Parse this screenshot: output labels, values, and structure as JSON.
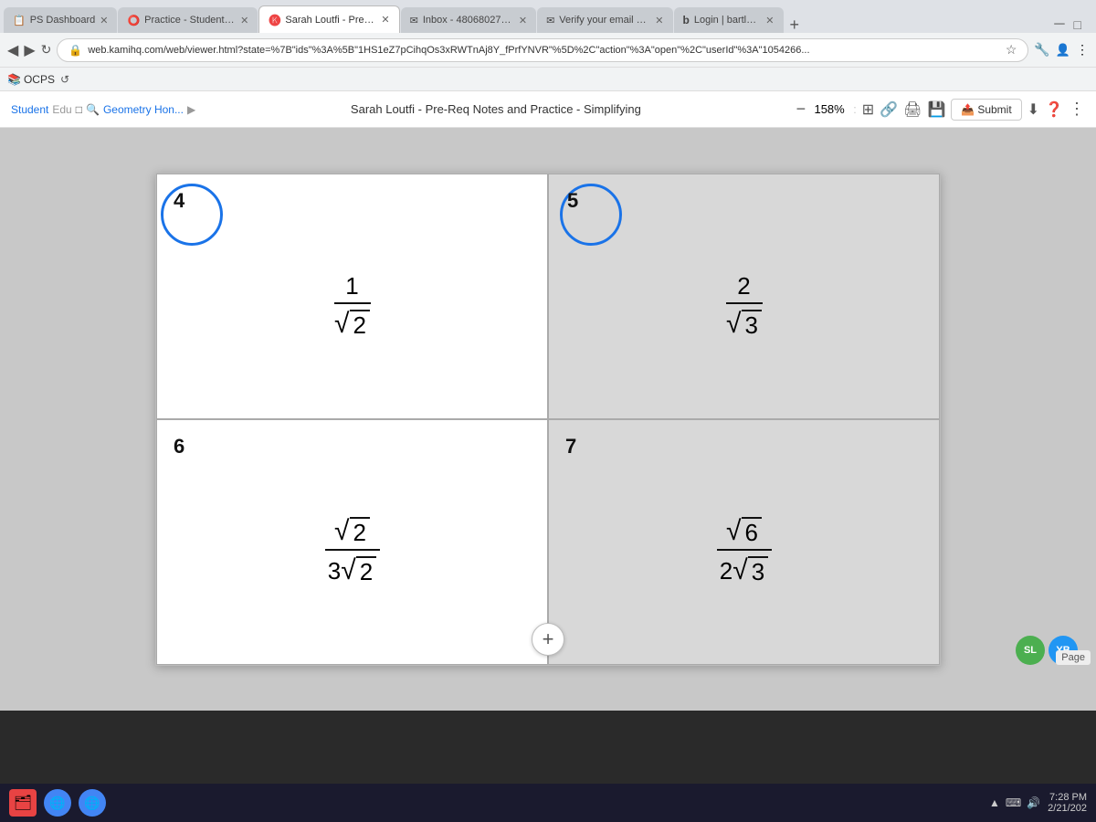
{
  "browser": {
    "tabs": [
      {
        "id": "tab1",
        "label": "PS Dashboard",
        "active": false,
        "icon": "📋"
      },
      {
        "id": "tab2",
        "label": "Practice - Student Cop...",
        "active": false,
        "icon": "⭕"
      },
      {
        "id": "tab3",
        "label": "Sarah Loutfi - Pre-Req...",
        "active": true,
        "icon": "🅚"
      },
      {
        "id": "tab4",
        "label": "Inbox - 4806802792@...",
        "active": false,
        "icon": "✉"
      },
      {
        "id": "tab5",
        "label": "Verify your email addre...",
        "active": false,
        "icon": "✉"
      },
      {
        "id": "tab6",
        "label": "Login | bartleby",
        "active": false,
        "icon": "b"
      }
    ],
    "url": "web.kamihq.com/web/viewer.html?state=%7B\"ids\"%3A%5B\"1HS1eZ7pCihqOs3xRWTnAj8Y_fPrfYNVR\"%5D%2C\"action\"%3A\"open\"%2C\"userId\"%3A\"1054266...",
    "new_tab_label": "+"
  },
  "toolbar_items": [
    "OCPS"
  ],
  "kamihq": {
    "breadcrumb": {
      "student": "Student",
      "edu": "Edu",
      "geometry": "Geometry Hon...",
      "arrow": "▶",
      "page_title": "Sarah Loutfi - Pre-Req Notes and Practice - Simplifying"
    },
    "zoom": {
      "minus": "−",
      "value": "158%",
      "plus": "+"
    },
    "icons": [
      "sort",
      "share",
      "print",
      "save",
      "submit",
      "download",
      "help",
      "menu"
    ],
    "submit_label": "Submit"
  },
  "worksheet": {
    "cells": [
      {
        "number": "4",
        "circled": true,
        "content_type": "fraction",
        "numerator": "1",
        "denominator_type": "sqrt",
        "denominator_value": "2"
      },
      {
        "number": "5",
        "circled": true,
        "content_type": "fraction",
        "numerator": "2",
        "denominator_type": "sqrt",
        "denominator_value": "3",
        "highlighted": true
      },
      {
        "number": "6",
        "circled": false,
        "content_type": "fraction",
        "numerator_type": "sqrt",
        "numerator_value": "2",
        "denominator_coeff": "3",
        "denominator_type": "sqrt",
        "denominator_value": "2"
      },
      {
        "number": "7",
        "circled": false,
        "content_type": "fraction",
        "numerator_type": "sqrt",
        "numerator_value": "6",
        "denominator_coeff": "2",
        "denominator_type": "sqrt",
        "denominator_value": "3",
        "highlighted": true
      }
    ]
  },
  "taskbar": {
    "icons": [
      "🗂",
      "🌐",
      "🔵"
    ],
    "avatars": [
      {
        "initials": "SL",
        "color": "#4caf50"
      },
      {
        "initials": "YB",
        "color": "#2196f3"
      }
    ],
    "time": "7:28 PM",
    "date": "2/21/202",
    "page_label": "Page"
  }
}
